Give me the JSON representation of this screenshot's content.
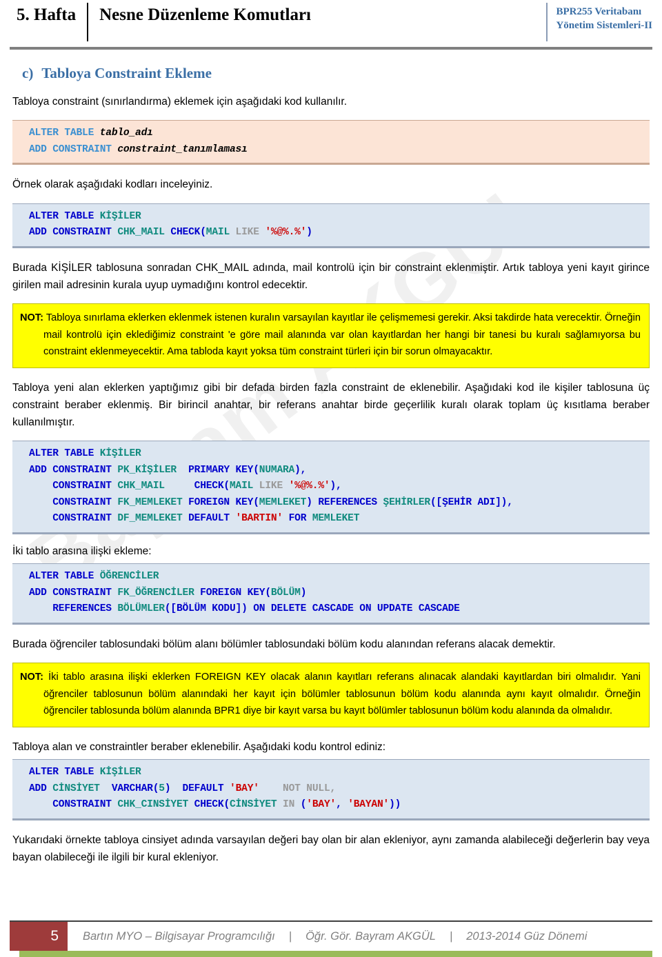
{
  "header": {
    "week": "5. Hafta",
    "title": "Nesne Düzenleme Komutları",
    "course_line1": "BPR255 Veritabanı",
    "course_line2": "Yönetim Sistemleri-II"
  },
  "watermark": "Bayram AKGÜL",
  "section": {
    "marker": "c)",
    "title": "Tabloya Constraint Ekleme"
  },
  "paragraphs": {
    "intro": "Tabloya constraint (sınırlandırma) eklemek için aşağıdaki kod kullanılır.",
    "example_lead": "Örnek olarak aşağıdaki kodları inceleyiniz.",
    "after_chk": "Burada KİŞİLER tablosuna sonradan CHK_MAIL adında, mail kontrolü için bir constraint eklenmiştir. Artık tabloya yeni kayıt girince girilen mail adresinin kurala uyup uymadığını kontrol edecektir.",
    "multi_constraint": "Tabloya yeni alan eklerken yaptığımız gibi bir defada birden fazla constraint de eklenebilir. Aşağıdaki kod ile kişiler tablosuna üç constraint beraber eklenmiş. Bir birincil anahtar, bir referans anahtar birde geçerlilik kuralı olarak toplam üç kısıtlama beraber kullanılmıştır.",
    "relation_lead": "İki tablo arasına ilişki ekleme:",
    "after_fk": "Burada öğrenciler tablosundaki bölüm alanı bölümler tablosundaki bölüm kodu alanından referans alacak demektir.",
    "field_and_constraint_lead": "Tabloya alan ve constraintler beraber eklenebilir. Aşağıdaki kodu kontrol ediniz:",
    "closing": "Yukarıdaki örnekte tabloya cinsiyet adında varsayılan değeri bay olan bir alan ekleniyor, aynı zamanda alabileceği değerlerin bay veya bayan olabileceği ile ilgili bir kural ekleniyor."
  },
  "notes": {
    "note1": {
      "label": "NOT:",
      "text": "Tabloya sınırlama eklerken eklenmek istenen kuralın varsayılan kayıtlar ile çelişmemesi gerekir. Aksi takdirde hata verecektir. Örneğin mail kontrolü için eklediğimiz constraint 'e göre mail alanında var olan kayıtlardan her hangi bir tanesi bu kuralı sağlamıyorsa bu constraint eklenmeyecektir. Ama tabloda kayıt yoksa tüm constraint türleri için bir sorun olmayacaktır."
    },
    "note2": {
      "label": "NOT:",
      "text": "İki tablo arasına ilişki eklerken FOREIGN KEY olacak alanın kayıtları referans alınacak alandaki kayıtlardan biri olmalıdır. Yani öğrenciler tablosunun bölüm alanındaki her kayıt için bölümler tablosunun bölüm kodu alanında aynı kayıt olmalıdır. Örneğin öğrenciler tablosunda bölüm alanında BPR1 diye bir kayıt varsa bu kayıt bölümler tablosunun bölüm kodu alanında da olmalıdır."
    }
  },
  "code_blocks": {
    "syntax": {
      "style": "peach",
      "line1_kw": "ALTER TABLE ",
      "line1_pl": "tablo_adı",
      "line2_kw": "ADD CONSTRAINT ",
      "line2_pl": "constraint_tanımlaması"
    },
    "chk_mail": {
      "style": "blue",
      "l1_kw": "ALTER TABLE ",
      "l1_id": "KİŞİLER",
      "l2_kw": "ADD CONSTRAINT ",
      "l2_id": "CHK_MAIL",
      "l2_kw2": " CHECK",
      "l2_p1": "(",
      "l2_id2": "MAIL",
      "l2_dim": " LIKE ",
      "l2_str": "'%@%.%'",
      "l2_p2": ")"
    },
    "multi": {
      "style": "blue",
      "l1_kw": "ALTER TABLE ",
      "l1_id": "KİŞİLER",
      "l2_kw": "ADD CONSTRAINT ",
      "l2_id": "PK_KİŞİLER",
      "l2_kw2": "  PRIMARY KEY",
      "l2_p1": "(",
      "l2_id2": "NUMARA",
      "l2_p2": "),",
      "l3_kw": "    CONSTRAINT ",
      "l3_id": "CHK_MAIL",
      "l3_kw2": "     CHECK",
      "l3_p1": "(",
      "l3_id2": "MAIL",
      "l3_dim": " LIKE ",
      "l3_str": "'%@%.%'",
      "l3_p2": "),",
      "l4_kw": "    CONSTRAINT ",
      "l4_id": "FK_MEMLEKET",
      "l4_kw2": " FOREIGN KEY",
      "l4_p1": "(",
      "l4_id2": "MEMLEKET",
      "l4_p2": ") ",
      "l4_kw3": "REFERENCES ",
      "l4_id3": "ŞEHİRLER",
      "l4_p3": "([ŞEHİR ADI]),",
      "l5_kw": "    CONSTRAINT ",
      "l5_id": "DF_MEMLEKET",
      "l5_kw2": " DEFAULT ",
      "l5_str": "'BARTIN'",
      "l5_kw3": " FOR ",
      "l5_id2": "MEMLEKET"
    },
    "ogrenciler_fk": {
      "style": "blue",
      "l1_kw": "ALTER TABLE ",
      "l1_id": "ÖĞRENCİLER",
      "l2_kw": "ADD CONSTRAINT ",
      "l2_id": "FK_ÖĞRENCİLER",
      "l2_kw2": " FOREIGN KEY",
      "l2_p1": "(",
      "l2_id2": "BÖLÜM",
      "l2_p2": ")",
      "l3_kw": "    REFERENCES ",
      "l3_id": "BÖLÜMLER",
      "l3_p1": "([BÖLÜM KODU]) ",
      "l3_kw2": "ON DELETE CASCADE ON UPDATE CASCADE"
    },
    "cinsiyet": {
      "style": "blue",
      "l1_kw": "ALTER TABLE ",
      "l1_id": "KİŞİLER",
      "l2_kw": "ADD ",
      "l2_id": "CİNSİYET",
      "l2_kw2": "  VARCHAR",
      "l2_p1": "(",
      "l2_num": "5",
      "l2_p2": ")  ",
      "l2_kw3": "DEFAULT ",
      "l2_str": "'BAY'",
      "l2_dim": "    NOT NULL,",
      "l3_kw": "    CONSTRAINT ",
      "l3_id": "CHK_CINSİYET",
      "l3_kw2": " CHECK",
      "l3_p1": "(",
      "l3_id2": "CİNSİYET",
      "l3_dim": " IN ",
      "l3_p2": "(",
      "l3_str1": "'BAY'",
      "l3_p3": ", ",
      "l3_str2": "'BAYAN'",
      "l3_p4": "))"
    }
  },
  "footer": {
    "page_number": "5",
    "institution": "Bartın MYO – Bilgisayar Programcılığı",
    "separator": "|",
    "instructor": "Öğr. Gör. Bayram AKGÜL",
    "term": "2013-2014 Güz Dönemi"
  }
}
